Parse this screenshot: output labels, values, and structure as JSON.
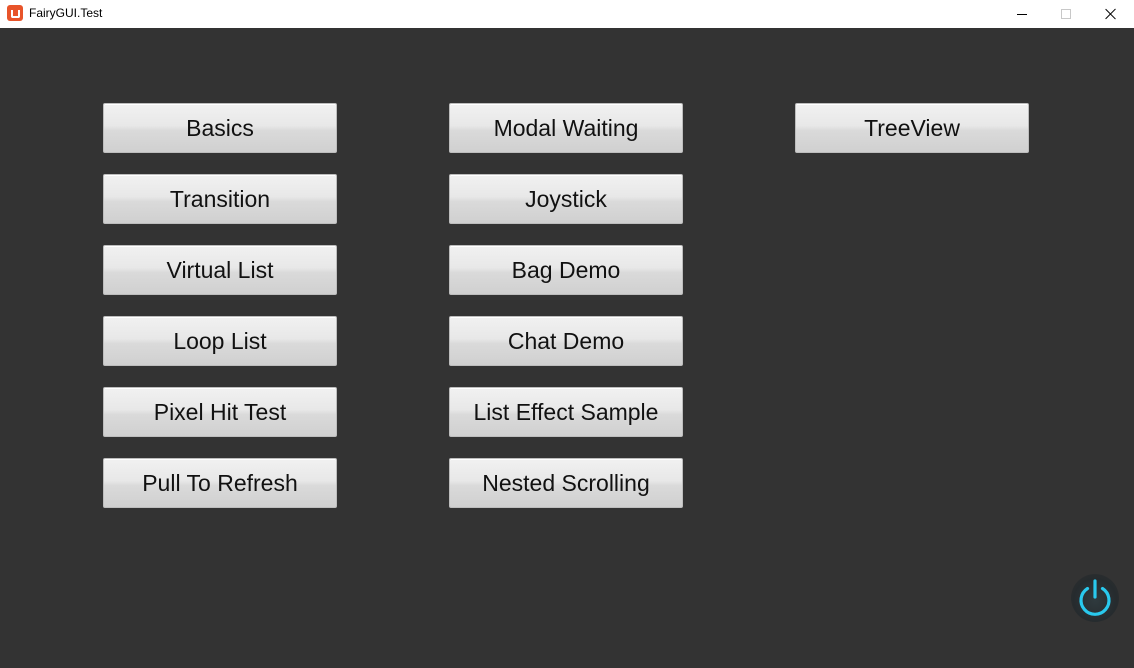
{
  "window": {
    "title": "FairyGUI.Test",
    "icon": "fairygui-app-icon"
  },
  "window_controls": {
    "minimize_icon": "minimize-icon",
    "maximize_icon": "maximize-icon",
    "close_icon": "close-icon"
  },
  "demo_buttons": {
    "basics": "Basics",
    "transition": "Transition",
    "virtual_list": "Virtual List",
    "loop_list": "Loop List",
    "pixel_hit_test": "Pixel Hit Test",
    "pull_to_refresh": "Pull To Refresh",
    "modal_waiting": "Modal Waiting",
    "joystick": "Joystick",
    "bag_demo": "Bag Demo",
    "chat_demo": "Chat Demo",
    "list_effect_sample": "List Effect Sample",
    "nested_scrolling": "Nested Scrolling",
    "treeview": "TreeView"
  },
  "power_button": {
    "icon": "power-icon",
    "accent_color": "#29c9ee"
  },
  "colors": {
    "stage_background": "#333333",
    "titlebar_background": "#ffffff",
    "app_icon": "#e8542a"
  }
}
